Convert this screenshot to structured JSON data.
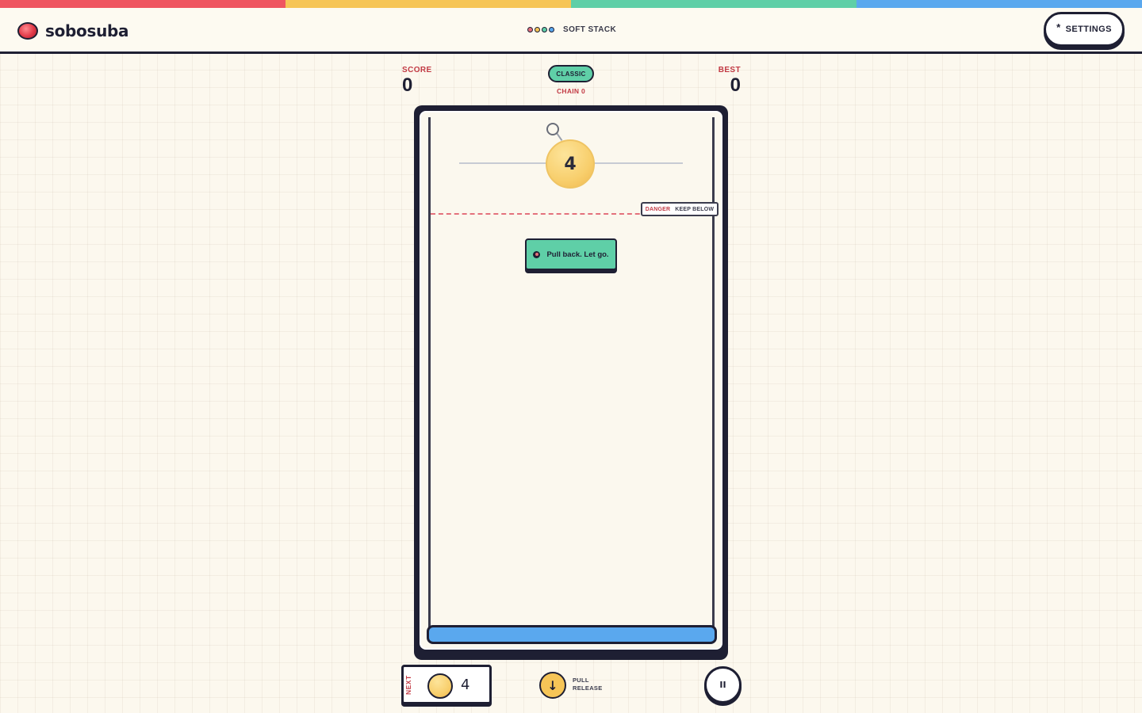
{
  "app": {
    "name": "sobosuba",
    "mode_tag": "SOFT STACK",
    "mode_tag_dots": [
      "#e4717c",
      "#f6c557",
      "#5fcfa7",
      "#5aa8ee"
    ],
    "stripe_colors": [
      "#ef5560",
      "#f6c557",
      "#5fcfa7",
      "#5aa8ee"
    ]
  },
  "header": {
    "settings_icon": "*",
    "settings_label": "SETTINGS"
  },
  "stats": {
    "score_label": "SCORE",
    "score_value": "0",
    "best_label": "BEST",
    "best_value": "0",
    "mode_label": "CLASSIC",
    "chain_label": "CHAIN 0"
  },
  "board": {
    "danger_word": "DANGER",
    "keep_word": "KEEP BELOW",
    "ball_value": "4",
    "ball_color": "#f8cf6d",
    "hint_text": "Pull back. Let go.",
    "floor_color": "#5aa8ee"
  },
  "footer": {
    "next_label": "NEXT",
    "next_value": "4",
    "pull_icon": "↓",
    "pull_line1": "PULL",
    "pull_line2": "RELEASE",
    "pause_icon": "II"
  }
}
